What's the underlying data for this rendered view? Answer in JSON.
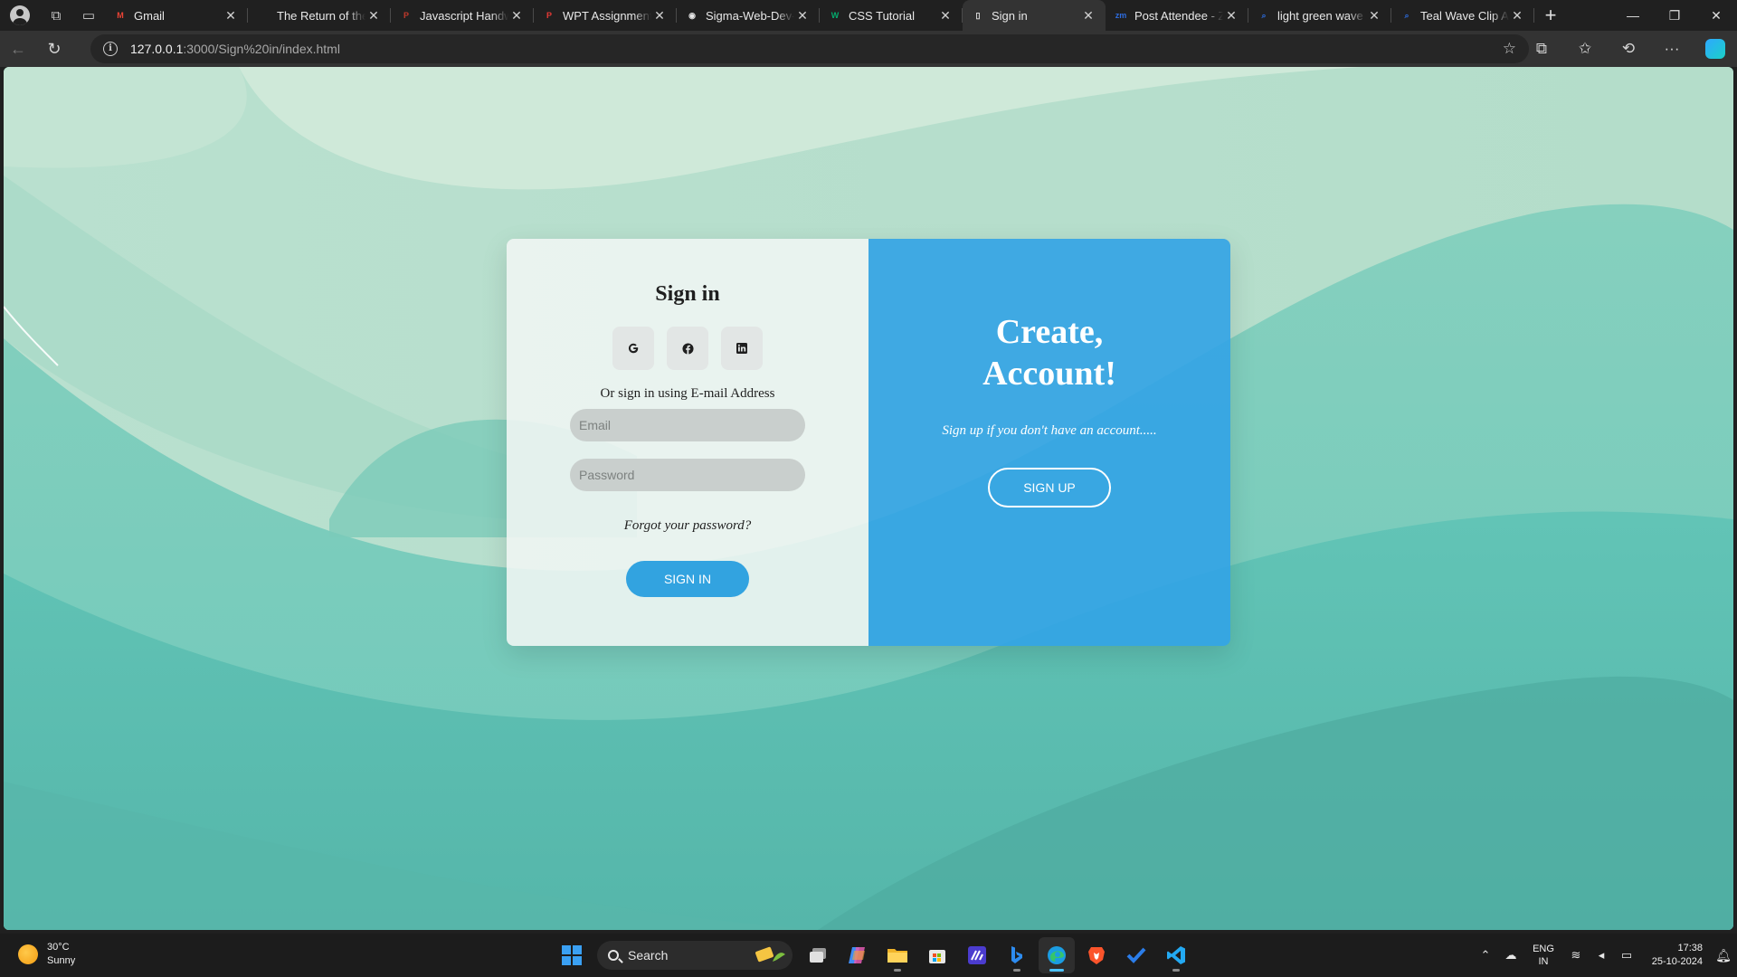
{
  "browser": {
    "tabs": [
      {
        "title": "Gmail",
        "favicon": "gmail-icon",
        "color": "#ea4335",
        "glyph": "M"
      },
      {
        "title": "The Return of the",
        "favicon": "page-icon",
        "color": "#3a3a3a",
        "glyph": ""
      },
      {
        "title": "Javascript Handw",
        "favicon": "pdf-icon",
        "color": "#c0392b",
        "glyph": "P"
      },
      {
        "title": "WPT Assignment",
        "favicon": "pdf-icon",
        "color": "#e53935",
        "glyph": "P"
      },
      {
        "title": "Sigma-Web-Dev-C",
        "favicon": "github-icon",
        "color": "#e6e6e6",
        "glyph": "◉"
      },
      {
        "title": "CSS Tutorial",
        "favicon": "w3schools-icon",
        "color": "#04aa6d",
        "glyph": "W"
      },
      {
        "title": "Sign in",
        "favicon": "document-icon",
        "color": "#e6e6e6",
        "glyph": "▯",
        "active": true
      },
      {
        "title": "Post Attendee - Z",
        "favicon": "zoom-icon",
        "color": "#2d6cdf",
        "glyph": "zm"
      },
      {
        "title": "light green wave b",
        "favicon": "search-icon",
        "color": "#2d6cdf",
        "glyph": "⌕"
      },
      {
        "title": "Teal Wave Clip Art",
        "favicon": "search-icon",
        "color": "#2d6cdf",
        "glyph": "⌕"
      }
    ],
    "url_host": "127.0.0.1",
    "url_path": ":3000/Sign%20in/index.html"
  },
  "signin": {
    "title": "Sign in",
    "social": [
      {
        "name": "google-icon",
        "glyph": "G"
      },
      {
        "name": "facebook-icon",
        "glyph": "f"
      },
      {
        "name": "linkedin-icon",
        "glyph": "in"
      }
    ],
    "or_text": "Or sign in using E-mail Address",
    "email_placeholder": "Email",
    "password_placeholder": "Password",
    "forgot": "Forgot your password?",
    "button": "SIGN IN"
  },
  "signup": {
    "title_line1": "Create,",
    "title_line2": "Account!",
    "subtitle": "Sign up if you don't have an account.....",
    "button": "SIGN UP"
  },
  "taskbar": {
    "weather_temp": "30°C",
    "weather_desc": "Sunny",
    "search_label": "Search",
    "lang_line1": "ENG",
    "lang_line2": "IN",
    "time": "17:38",
    "date": "25-10-2024"
  },
  "colors": {
    "accent": "#32a3e0",
    "panel_right": "#32a3e6",
    "bg_teal": "#5fc2b4"
  }
}
